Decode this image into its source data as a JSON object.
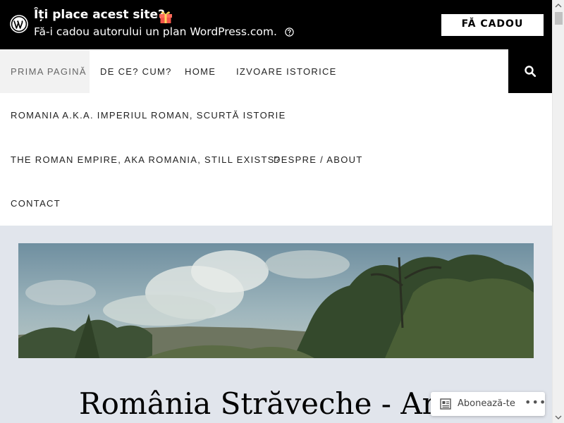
{
  "promo": {
    "title": "Îți place acest site?",
    "subtitle": "Fă-i cadou autorului un plan WordPress.com.",
    "button_label": "FĂ CADOU",
    "icons": [
      "wordpress-logo-icon",
      "gift-icon",
      "help-icon"
    ]
  },
  "nav": {
    "items": [
      {
        "label": "PRIMA PAGINĂ",
        "active": true
      },
      {
        "label": "DE CE? CUM?"
      },
      {
        "label": "HOME"
      },
      {
        "label": "IZVOARE ISTORICE"
      },
      {
        "label": "ROMANIA A.K.A. IMPERIUL ROMAN, SCURTĂ ISTORIE"
      },
      {
        "label": "THE ROMAN EMPIRE, AKA ROMANIA, STILL EXISTS?"
      },
      {
        "label": "DESPRE / ABOUT"
      },
      {
        "label": "CONTACT"
      }
    ],
    "search_icon": "search-icon"
  },
  "site": {
    "title": "România Străveche - Ancient"
  },
  "subscribe": {
    "label": "Abonează-te",
    "more": "•••"
  },
  "colors": {
    "promo_bg": "#000000",
    "page_bg": "#e1e5ec",
    "nav_active_bg": "#f2f2f2"
  }
}
